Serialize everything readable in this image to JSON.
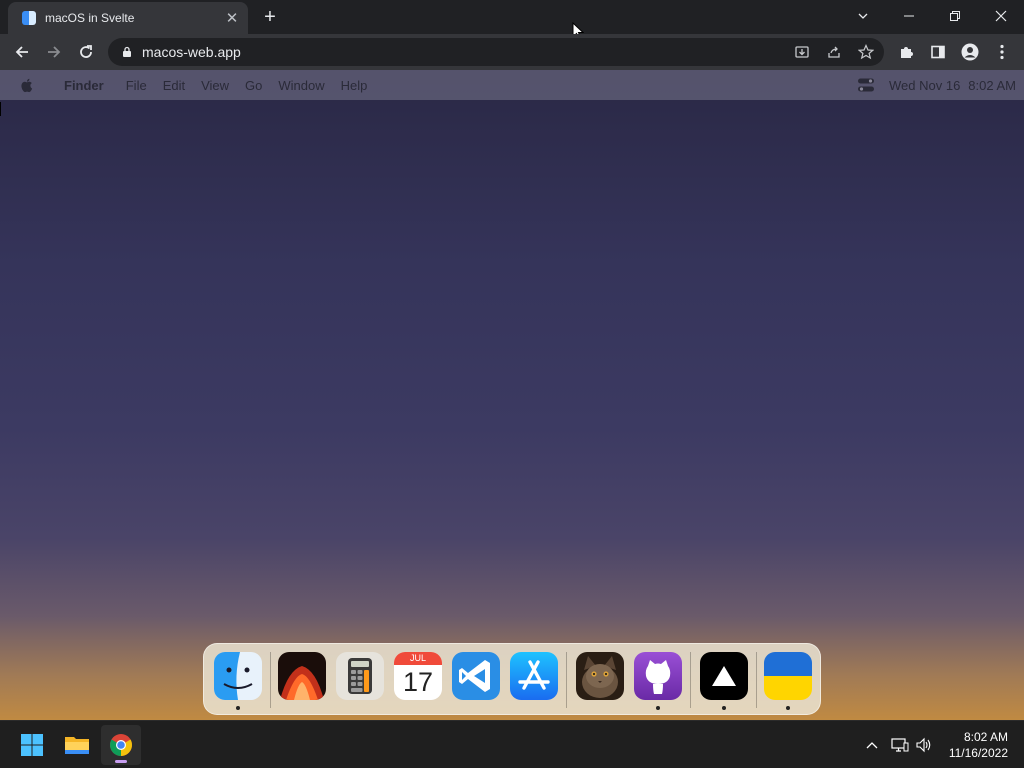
{
  "browser": {
    "tab_title": "macOS in Svelte",
    "url": "macos-web.app"
  },
  "mac_menubar": {
    "app_name": "Finder",
    "menus": [
      "File",
      "Edit",
      "View",
      "Go",
      "Window",
      "Help"
    ],
    "date": "Wed Nov 16",
    "time": "8:02 AM"
  },
  "dock": {
    "apps": [
      {
        "name": "finder-icon",
        "running": true
      },
      {
        "name": "wallpapers-icon",
        "running": false
      },
      {
        "name": "calculator-icon",
        "running": false
      },
      {
        "name": "calendar-icon",
        "running": false,
        "month": "JUL",
        "day": "17"
      },
      {
        "name": "vscode-icon",
        "running": false
      },
      {
        "name": "app-store-icon",
        "running": false
      },
      {
        "name": "cat-photo-icon",
        "running": false
      },
      {
        "name": "github-icon",
        "running": true
      },
      {
        "name": "vercel-icon",
        "running": true
      },
      {
        "name": "ukraine-flag-icon",
        "running": true
      }
    ]
  },
  "taskbar": {
    "time": "8:02 AM",
    "date": "11/16/2022"
  },
  "colors": {
    "accent_blue": "#3a8ef5",
    "ukraine_blue": "#1f6fd6",
    "ukraine_yellow": "#ffd500"
  }
}
